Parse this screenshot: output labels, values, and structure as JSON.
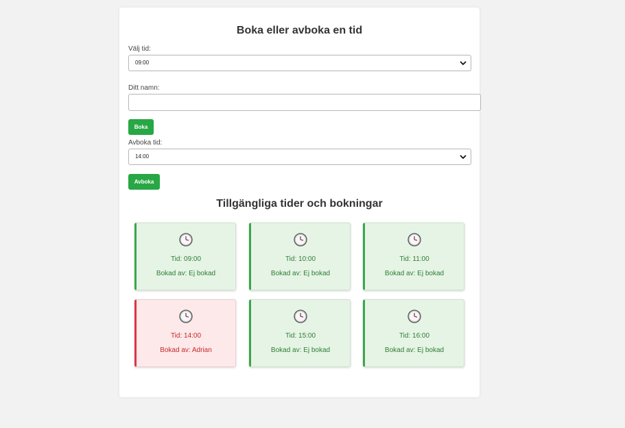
{
  "title": "Boka eller avboka en tid",
  "book": {
    "label": "Välj tid:",
    "selected": "09:00",
    "name_label": "Ditt namn:",
    "name_value": "",
    "button": "Boka"
  },
  "cancel": {
    "label": "Avboka tid:",
    "selected": "14:00",
    "button": "Avboka"
  },
  "slots_title": "Tillgängliga tider och bokningar",
  "slots": [
    {
      "time": "Tid: 09:00",
      "booker": "Bokad av: Ej bokad",
      "status": "free"
    },
    {
      "time": "Tid: 10:00",
      "booker": "Bokad av: Ej bokad",
      "status": "free"
    },
    {
      "time": "Tid: 11:00",
      "booker": "Bokad av: Ej bokad",
      "status": "free"
    },
    {
      "time": "Tid: 14:00",
      "booker": "Bokad av: Adrian",
      "status": "booked"
    },
    {
      "time": "Tid: 15:00",
      "booker": "Bokad av: Ej bokad",
      "status": "free"
    },
    {
      "time": "Tid: 16:00",
      "booker": "Bokad av: Ej bokad",
      "status": "free"
    }
  ],
  "colors": {
    "primary_button": "#28a745",
    "free_accent": "#3aa64a",
    "booked_accent": "#dc3545"
  }
}
